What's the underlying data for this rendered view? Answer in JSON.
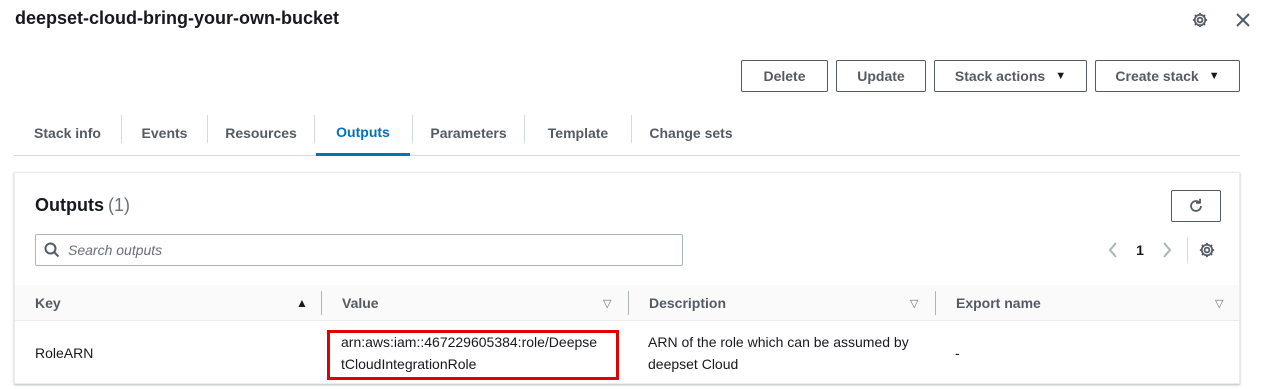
{
  "header": {
    "title": "deepset-cloud-bring-your-own-bucket"
  },
  "actions": {
    "delete": "Delete",
    "update": "Update",
    "stack_actions": "Stack actions",
    "create_stack": "Create stack"
  },
  "tabs": [
    {
      "label": "Stack info"
    },
    {
      "label": "Events"
    },
    {
      "label": "Resources"
    },
    {
      "label": "Outputs",
      "active": true
    },
    {
      "label": "Parameters"
    },
    {
      "label": "Template"
    },
    {
      "label": "Change sets"
    }
  ],
  "outputs": {
    "title": "Outputs",
    "count": "(1)",
    "search_placeholder": "Search outputs",
    "page": "1",
    "columns": {
      "key": "Key",
      "value": "Value",
      "description": "Description",
      "export_name": "Export name"
    },
    "rows": [
      {
        "key": "RoleARN",
        "value_line1": "arn:aws:iam::467229605384:role/Deepse",
        "value_line2": "tCloudIntegrationRole",
        "description_line1": "ARN of the role which can be assumed by",
        "description_line2": "deepset Cloud",
        "export_name": "-"
      }
    ]
  },
  "colors": {
    "accent": "#0073bb",
    "highlight": "#e00000"
  }
}
